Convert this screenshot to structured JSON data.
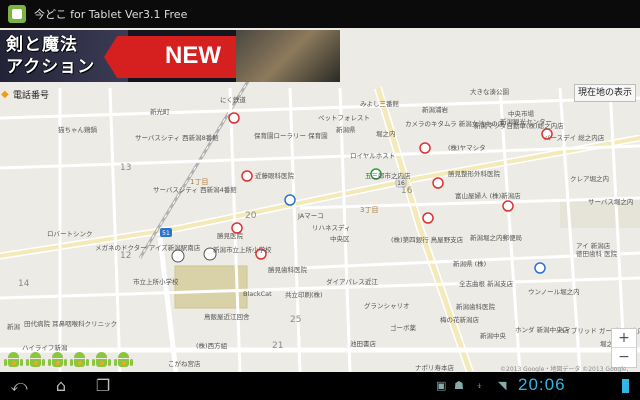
{
  "window": {
    "title": "今どこ for Tablet Ver3.1 Free"
  },
  "ad": {
    "text_line1": "剣と魔法",
    "text_line2": "アクション",
    "new_label": "NEW"
  },
  "info_bar": {
    "phone_label": "電話番号"
  },
  "map": {
    "current_location_label": "現在地の表示",
    "copyright": "©2013 Google・地図データ ©2013 Google, ZENRIN",
    "labels": [
      "にく鉄道",
      "新光町",
      "みよし三番館",
      "大きな湊公園",
      "中央市場",
      "新潟観光センター",
      "ペットフォレスト",
      "新潟浦岩",
      "カメラのキタムラ 新潟女池中の店",
      "新潟マツダ自動車(株)総之内店",
      "堀之内",
      "猫ちゃん鶏鍋",
      "サーバスシティ 西新潟8番館",
      "保育園ローラリー 保育園",
      "新潟県",
      "ロイヤルホスト",
      "(株)ヤマシタ",
      "バースデイ 総之内店",
      "近藤眼科医院",
      "五三郎市之内店",
      "勝見整形外科医院",
      "富山屋婦人 (株)新潟店",
      "クレア堀之内",
      "サーバスシティ 西新潟4番館",
      "サーバス堀之内",
      "JAマーコ",
      "リハネスディ",
      "ロバートシンク",
      "メガネのドクター アイズ新潟駅南店",
      "勝見医院",
      "新潟市立上所小学校",
      "中央区",
      "(株)第四銀行 鳥屋野支店",
      "新潟堀之内郵便局",
      "アイ 新潟店",
      "徳田歯科 医院",
      "勝見歯科医院",
      "市立上所小学校",
      "ダイアパレス近江",
      "新潟県 (株)",
      "全志曲根 新潟支店",
      "BlackCat",
      "共立印刷(株)",
      "グランシャリオ",
      "新潟歯科医院",
      "ウンノール堀之内",
      "田代病院 耳鼻咽喉科クリニック",
      "鳥飯屋近江回舎",
      "ゴーボ薬",
      "梅の花新潟店",
      "ハイライフ新潟",
      "新潟",
      "(株)西方組",
      "池田書店",
      "ホンダ 新潟中央店",
      "ハイブリッド ガーデン堀之内",
      "こがね宮店",
      "ナポリ寿本店",
      "新潟中央",
      "堀之内南",
      "1丁目",
      "3丁目",
      "13",
      "12",
      "14",
      "16",
      "25",
      "20",
      "21"
    ]
  },
  "bottom_bar": {
    "time": "20:06",
    "back_icon": "back-icon",
    "home_icon": "home-icon",
    "recent_apps_icon": "recent-apps-icon"
  },
  "colors": {
    "title_bg": "#0b0b0b",
    "map_bg": "#ecebe6",
    "road": "#ffffff",
    "green_area": "#c8dbb5",
    "accent_blue": "#33b5e5",
    "ad_red": "#d61f1f"
  }
}
